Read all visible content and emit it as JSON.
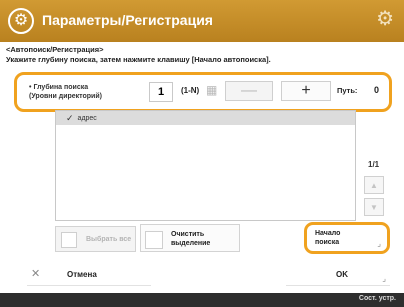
{
  "header": {
    "title": "Параметры/Регистрация",
    "title_icon": "gear-circle-icon",
    "settings_icon": "gear-icon"
  },
  "breadcrumb": "<Автопоиск/Регистрация>",
  "instruction": "Укажите глубину поиска, затем нажмите клавишу [Начало автопоиска].",
  "search_depth": {
    "label_line1": "Глубина поиска",
    "label_line2": "(Уровни директорий)",
    "value": "1",
    "range": "(1-N)",
    "minus_label": "—",
    "plus_label": "+",
    "path_label": "Путь:",
    "path_value": "0"
  },
  "tree": {
    "items": [
      {
        "label": "адрес",
        "checked": true
      }
    ]
  },
  "pagination": {
    "page": "1/1",
    "up_label": "▲",
    "down_label": "▼"
  },
  "buttons": {
    "select_all": "Выбрать все",
    "clear_line1": "Очистить",
    "clear_line2": "выделение",
    "start_line1": "Начало",
    "start_line2": "поиска",
    "cancel": "Отмена",
    "ok": "OK"
  },
  "status": {
    "text": "Сост. устр."
  },
  "colors": {
    "title_bar": "#c28c27",
    "highlight": "#f0a21f",
    "status_bar": "#2e2e2e"
  }
}
